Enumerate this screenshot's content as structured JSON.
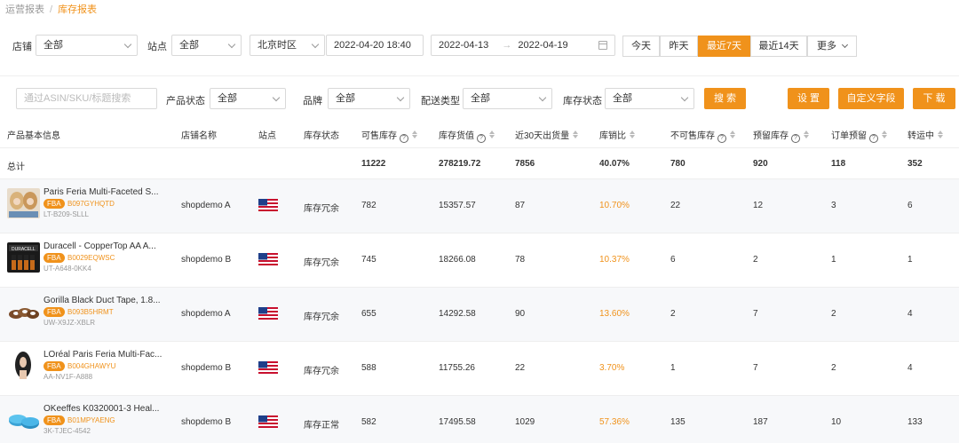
{
  "breadcrumb": {
    "parent": "运营报表",
    "separator": "/",
    "current": "库存报表"
  },
  "filters": {
    "shop_label": "店铺",
    "shop_value": "全部",
    "site_label": "站点",
    "site_value": "全部",
    "timezone_value": "北京时区",
    "datetime_value": "2022-04-20 18:40",
    "range_start": "2022-04-13",
    "range_arrow": "→",
    "range_end": "2022-04-19",
    "quick": [
      "今天",
      "昨天",
      "最近7天",
      "最近14天",
      "更多"
    ],
    "quick_active_index": 2
  },
  "filters2": {
    "search_placeholder": "通过ASIN/SKU/标题搜索",
    "status_label": "产品状态",
    "status_value": "全部",
    "brand_label": "品牌",
    "brand_value": "全部",
    "ship_label": "配送类型",
    "ship_value": "全部",
    "stock_label": "库存状态",
    "stock_value": "全部",
    "search_button": "搜 索",
    "settings_button": "设 置",
    "custom_fields_button": "自定义字段",
    "download_button": "下 载"
  },
  "table": {
    "headers": {
      "product": "产品基本信息",
      "shop": "店铺名称",
      "site": "站点",
      "status": "库存状态",
      "sellable": "可售库存",
      "value": "库存货值",
      "sales30": "近30天出货量",
      "ratio": "库销比",
      "unsellable": "不可售库存",
      "reserved": "预留库存",
      "order_reserved": "订单预留",
      "transit": "转运中"
    },
    "total": {
      "label": "总计",
      "sellable": "11222",
      "value": "278219.72",
      "sales30": "7856",
      "ratio": "40.07%",
      "unsellable": "780",
      "reserved": "920",
      "order_reserved": "118",
      "transit": "352"
    },
    "rows": [
      {
        "name": "Paris Feria Multi-Faceted S...",
        "fba": "FBA",
        "asin": "B097GYHQTD",
        "sku": "LT-B209-SLLL",
        "shop": "shopdemo A",
        "status": "库存冗余",
        "sellable": "782",
        "value": "15357.57",
        "sales30": "87",
        "ratio": "10.70%",
        "unsellable": "22",
        "reserved": "12",
        "order_reserved": "3",
        "transit": "6",
        "thumb_icon": "hair-dye-icon",
        "flag_icon": "us-flag-icon"
      },
      {
        "name": "Duracell - CopperTop AA A...",
        "fba": "FBA",
        "asin": "B0029EQWSC",
        "sku": "UT-A648-0KK4",
        "shop": "shopdemo B",
        "status": "库存冗余",
        "sellable": "745",
        "value": "18266.08",
        "sales30": "78",
        "ratio": "10.37%",
        "unsellable": "6",
        "reserved": "2",
        "order_reserved": "1",
        "transit": "1",
        "thumb_icon": "battery-icon",
        "flag_icon": "us-flag-icon"
      },
      {
        "name": "Gorilla Black Duct Tape, 1.8...",
        "fba": "FBA",
        "asin": "B093B5HRMT",
        "sku": "UW-X9JZ-XBLR",
        "shop": "shopdemo A",
        "status": "库存冗余",
        "sellable": "655",
        "value": "14292.58",
        "sales30": "90",
        "ratio": "13.60%",
        "unsellable": "2",
        "reserved": "7",
        "order_reserved": "2",
        "transit": "4",
        "thumb_icon": "tape-icon",
        "flag_icon": "us-flag-icon"
      },
      {
        "name": "LOréal Paris Feria Multi-Fac...",
        "fba": "FBA",
        "asin": "B004GHAWYU",
        "sku": "AA-NV1F-A888",
        "shop": "shopdemo B",
        "status": "库存冗余",
        "sellable": "588",
        "value": "11755.26",
        "sales30": "22",
        "ratio": "3.70%",
        "unsellable": "1",
        "reserved": "7",
        "order_reserved": "2",
        "transit": "4",
        "thumb_icon": "hair-model-icon",
        "flag_icon": "us-flag-icon"
      },
      {
        "name": "OKeeffes K0320001-3 Heal...",
        "fba": "FBA",
        "asin": "B01MPYAENG",
        "sku": "3K-TJEC-4542",
        "shop": "shopdemo B",
        "status": "库存正常",
        "sellable": "582",
        "value": "17495.58",
        "sales30": "1029",
        "ratio": "57.36%",
        "unsellable": "135",
        "reserved": "187",
        "order_reserved": "10",
        "transit": "133",
        "thumb_icon": "cream-tin-icon",
        "flag_icon": "us-flag-icon"
      }
    ]
  },
  "colors": {
    "accent": "#f0921b"
  }
}
